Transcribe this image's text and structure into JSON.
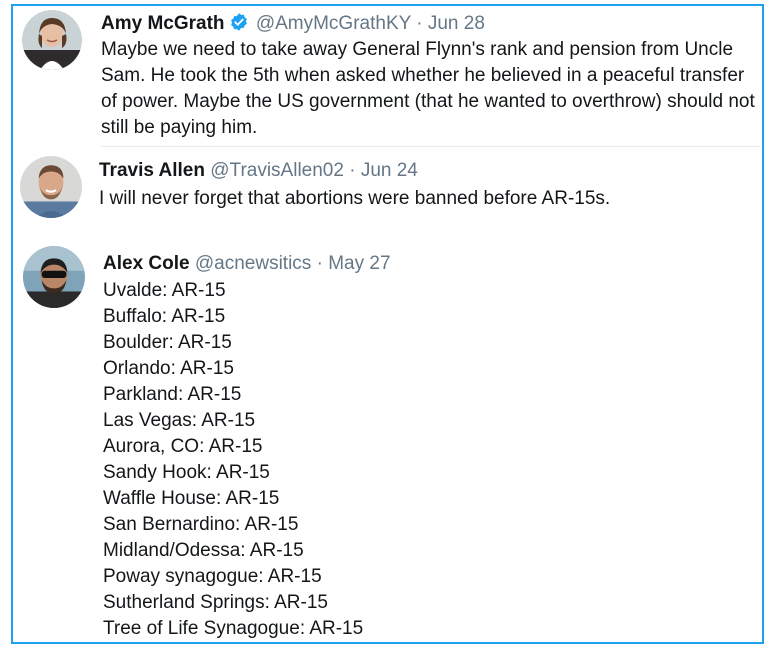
{
  "tweets": [
    {
      "name": "Amy McGrath",
      "verified": true,
      "handle": "@AmyMcGrathKY",
      "separator": "·",
      "date": "Jun 28",
      "text": "Maybe we need to take away General Flynn's rank and pension from Uncle Sam. He took the 5th when asked whether he believed in a peaceful transfer of power. Maybe the US government (that he wanted to overthrow) should not still be paying him."
    },
    {
      "name": "Travis Allen",
      "verified": false,
      "handle": "@TravisAllen02",
      "separator": "·",
      "date": "Jun 24",
      "text": "I will never forget that abortions were banned before AR-15s."
    },
    {
      "name": "Alex Cole",
      "verified": false,
      "handle": "@acnewsitics",
      "separator": "·",
      "date": "May 27",
      "lines": [
        "Uvalde: AR-15",
        "Buffalo: AR-15",
        "Boulder: AR-15",
        "Orlando: AR-15",
        "Parkland: AR-15",
        "Las Vegas: AR-15",
        "Aurora, CO: AR-15",
        "Sandy Hook: AR-15",
        "Waffle House: AR-15",
        "San Bernardino: AR-15",
        "Midland/Odessa: AR-15",
        "Poway synagogue: AR-15",
        "Sutherland Springs: AR-15",
        "Tree of Life Synagogue: AR-15"
      ]
    }
  ],
  "colors": {
    "border": "#1da1f2",
    "verified_badge": "#1da1f2",
    "secondary_text": "#657786"
  }
}
